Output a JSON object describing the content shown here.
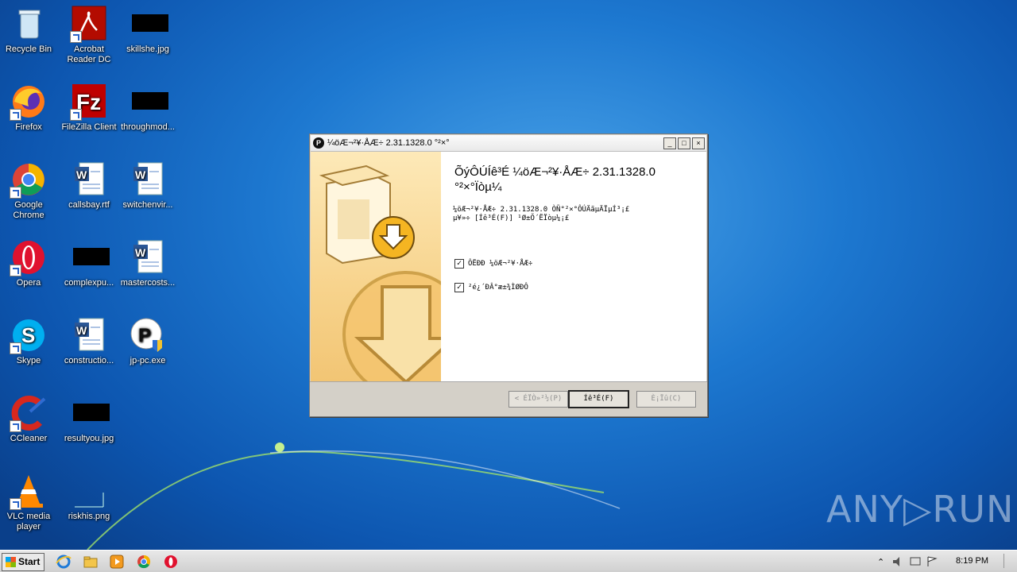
{
  "desktop": {
    "icons": [
      {
        "label": "Recycle Bin"
      },
      {
        "label": "Acrobat Reader DC"
      },
      {
        "label": "skillshe.jpg"
      },
      {
        "label": "Firefox"
      },
      {
        "label": "FileZilla Client"
      },
      {
        "label": "throughmod..."
      },
      {
        "label": "Google Chrome"
      },
      {
        "label": "callsbay.rtf"
      },
      {
        "label": "switchenvir..."
      },
      {
        "label": "Opera"
      },
      {
        "label": "complexpu..."
      },
      {
        "label": "mastercosts..."
      },
      {
        "label": "Skype"
      },
      {
        "label": "constructio..."
      },
      {
        "label": "jp-pc.exe"
      },
      {
        "label": "CCleaner"
      },
      {
        "label": "resultyou.jpg"
      },
      {
        "label": "VLC media player"
      },
      {
        "label": "riskhis.png"
      }
    ]
  },
  "installer": {
    "title": "¼öÆ¬²¥·ÅÆ÷ 2.31.1328.0 °²×°",
    "heading": "ÕýÔÚÍê³É ¼öÆ¬²¥·ÅÆ÷ 2.31.1328.0 °²×°Ïòµ¼",
    "description": "¼öÆ¬²¥·ÅÆ÷ 2.31.1328.0 ÒÑ°²×°ÔÚÄãµÄÏµÍ³¡£\nµ¥»÷ [Íê³É(F)] ¹Ø±Õ´ËÏòµ¼¡£",
    "checkbox_run": "ÔËÐÐ ¼öÆ¬²¥·ÅÆ÷",
    "checkbox_shortcut": "²é¿´ÐÂ°æ±¾ÌØÐÔ",
    "btn_back": "< ÉÏÒ»²½(P)",
    "btn_finish": "Íê³É(F)",
    "btn_cancel": "È¡Ïû(C)",
    "min": "_",
    "max": "□",
    "close": "×"
  },
  "taskbar": {
    "start": "Start",
    "clock": "8:19 PM"
  },
  "watermark": "ANY▷RUN"
}
